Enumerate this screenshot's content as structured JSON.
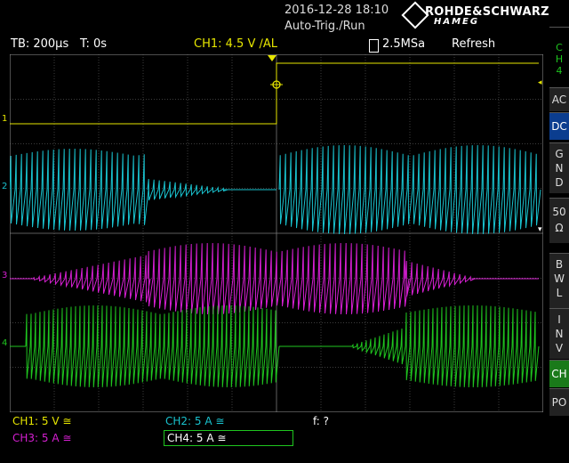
{
  "header": {
    "datetime": "2016-12-28 18:10",
    "mode": "Auto-Trig./Run",
    "brand_top": "ROHDE&SCHWARZ",
    "brand_bottom": "HAMEG"
  },
  "statusbar": {
    "timebase": "TB: 200µs",
    "trigger_time": "T: 0s",
    "trigger": "CH1: 4.5 V ∕AL",
    "sample_rate": "2.5MSa",
    "acq_mode": "Refresh"
  },
  "side": {
    "ch": "C\nH\n4",
    "ac": "AC",
    "dc": "DC",
    "gnd": "G\nN\nD",
    "fifty": "50\nΩ",
    "bwl": "B\nW\nL",
    "inv": "I\nN\nV",
    "ch2": "CH",
    "po": "PO"
  },
  "channels": [
    {
      "label": "CH1: 5 V ≅",
      "color": "#e6e600",
      "marker": "1"
    },
    {
      "label": "CH2: 5 A ≅",
      "color": "#19c3cf",
      "marker": "2"
    },
    {
      "label": "CH3: 5 A ≅",
      "color": "#d61fd2",
      "marker": "3"
    },
    {
      "label": "CH4: 5 A ≅",
      "color": "#1fc61f",
      "marker": "4"
    }
  ],
  "freq": "f: ?",
  "colors": {
    "ch1": "#e6e600",
    "ch2": "#19c3cf",
    "ch3": "#d61fd2",
    "ch4": "#1fc61f",
    "grid": "#7a7a7a",
    "active_btn": "#0b3d8f"
  }
}
